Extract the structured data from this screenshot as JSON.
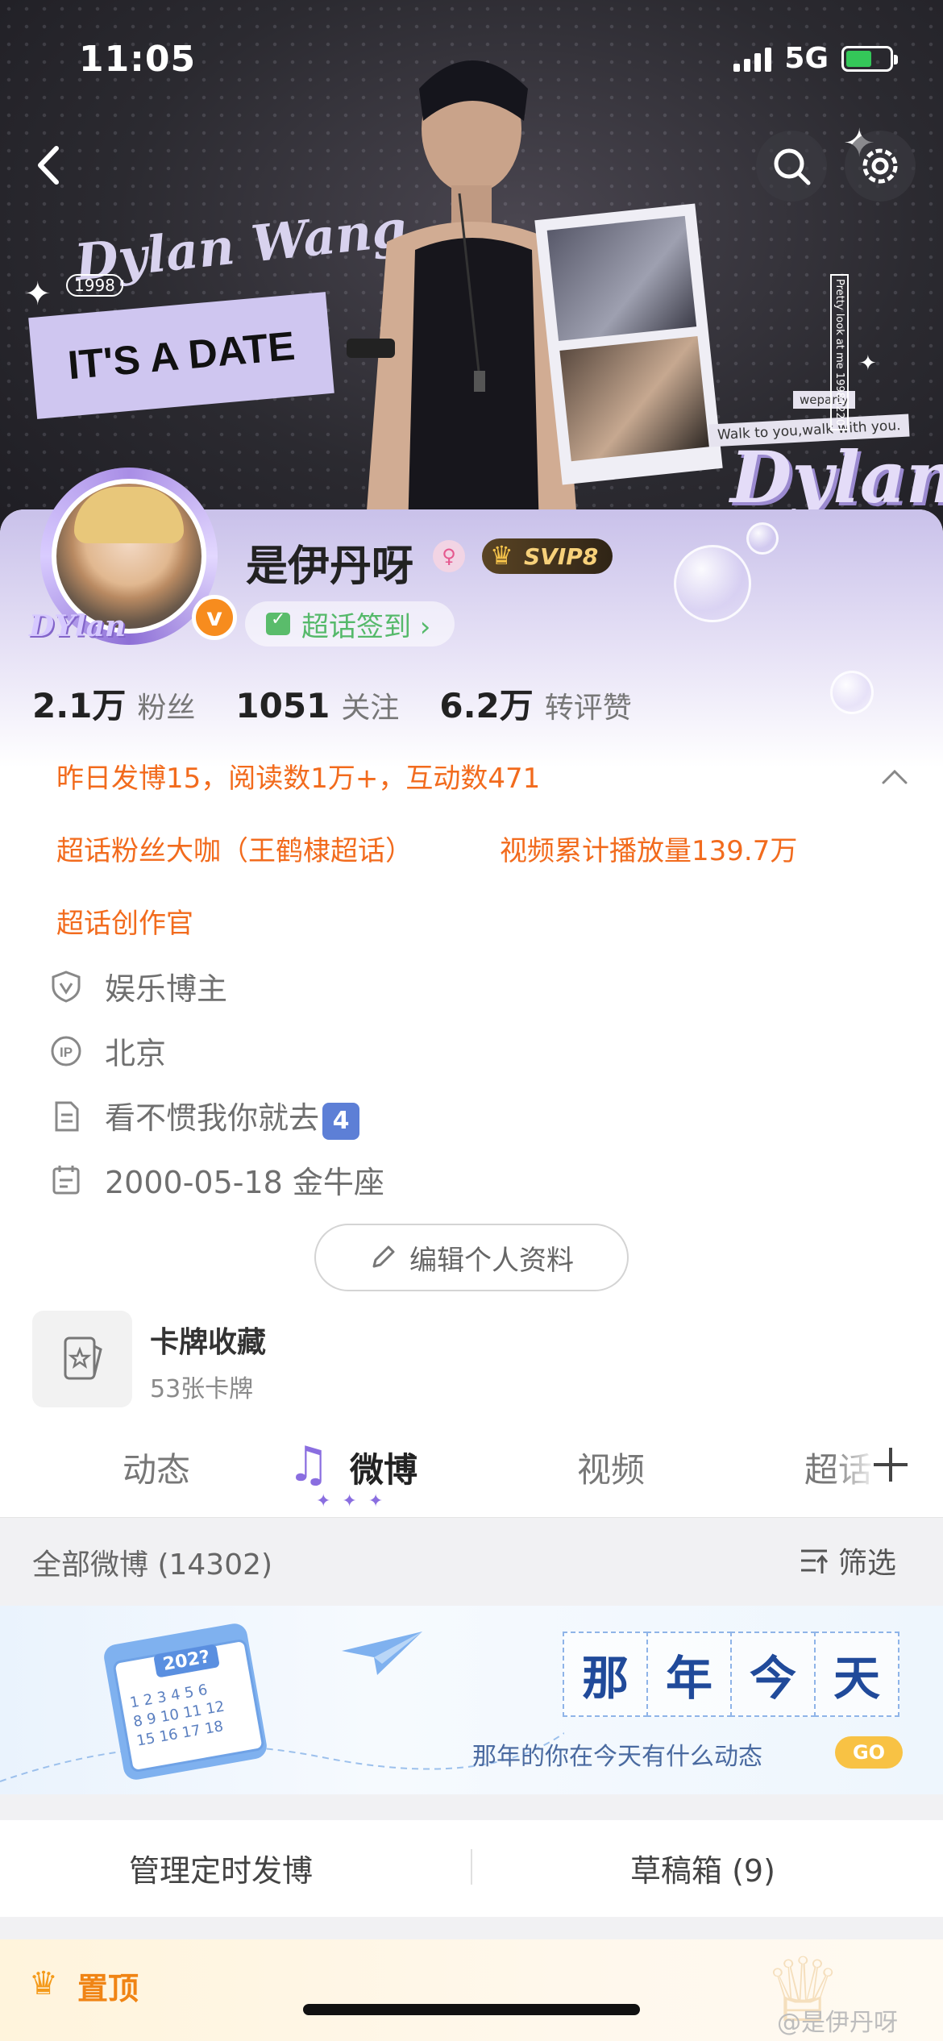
{
  "status_bar": {
    "time": "11:05",
    "network": "5G"
  },
  "banner": {
    "name_art": "Dylan Wang",
    "year_tag": "1998",
    "date_text": "IT'S A DATE",
    "side_text": "Pretty look at me 19981220",
    "tag_small": "weparty",
    "tag_caption": "Walk to you,walk with you.",
    "big_script": "Dylan"
  },
  "profile": {
    "avatar_word": "DYlan",
    "username": "是伊丹呀",
    "svip_label": "SVIP8",
    "checkin_label": "超话签到 ›",
    "stats": [
      {
        "num": "2.1万",
        "label": "粉丝"
      },
      {
        "num": "1051",
        "label": "关注"
      },
      {
        "num": "6.2万",
        "label": "转评赞"
      }
    ]
  },
  "highlights": {
    "yesterday": "昨日发博15，阅读数1万+，互动数471",
    "fan_title": "超话粉丝大咖（王鹤棣超话）",
    "video_plays": "视频累计播放量139.7万",
    "creator": "超话创作官"
  },
  "info": {
    "category": "娱乐博主",
    "location": "北京",
    "bio": "看不惯我你就去",
    "bio_emoji": "4",
    "birthday": "2000-05-18 金牛座"
  },
  "edit_button": "编辑个人资料",
  "card_collection": {
    "title": "卡牌收藏",
    "count": "53张卡牌"
  },
  "tabs": [
    "动态",
    "微博",
    "视频",
    "超话"
  ],
  "feed": {
    "filter_title": "全部微博 (14302)",
    "filter_button": "筛选"
  },
  "on_this_day": {
    "year": "202?",
    "chars": [
      "那",
      "年",
      "今",
      "天"
    ],
    "subtitle": "那年的你在今天有什么动态",
    "go": "GO"
  },
  "manage": {
    "scheduled": "管理定时发博",
    "drafts": "草稿箱 (9)"
  },
  "pinned": {
    "label": "置顶"
  },
  "watermark": "@是伊丹呀"
}
